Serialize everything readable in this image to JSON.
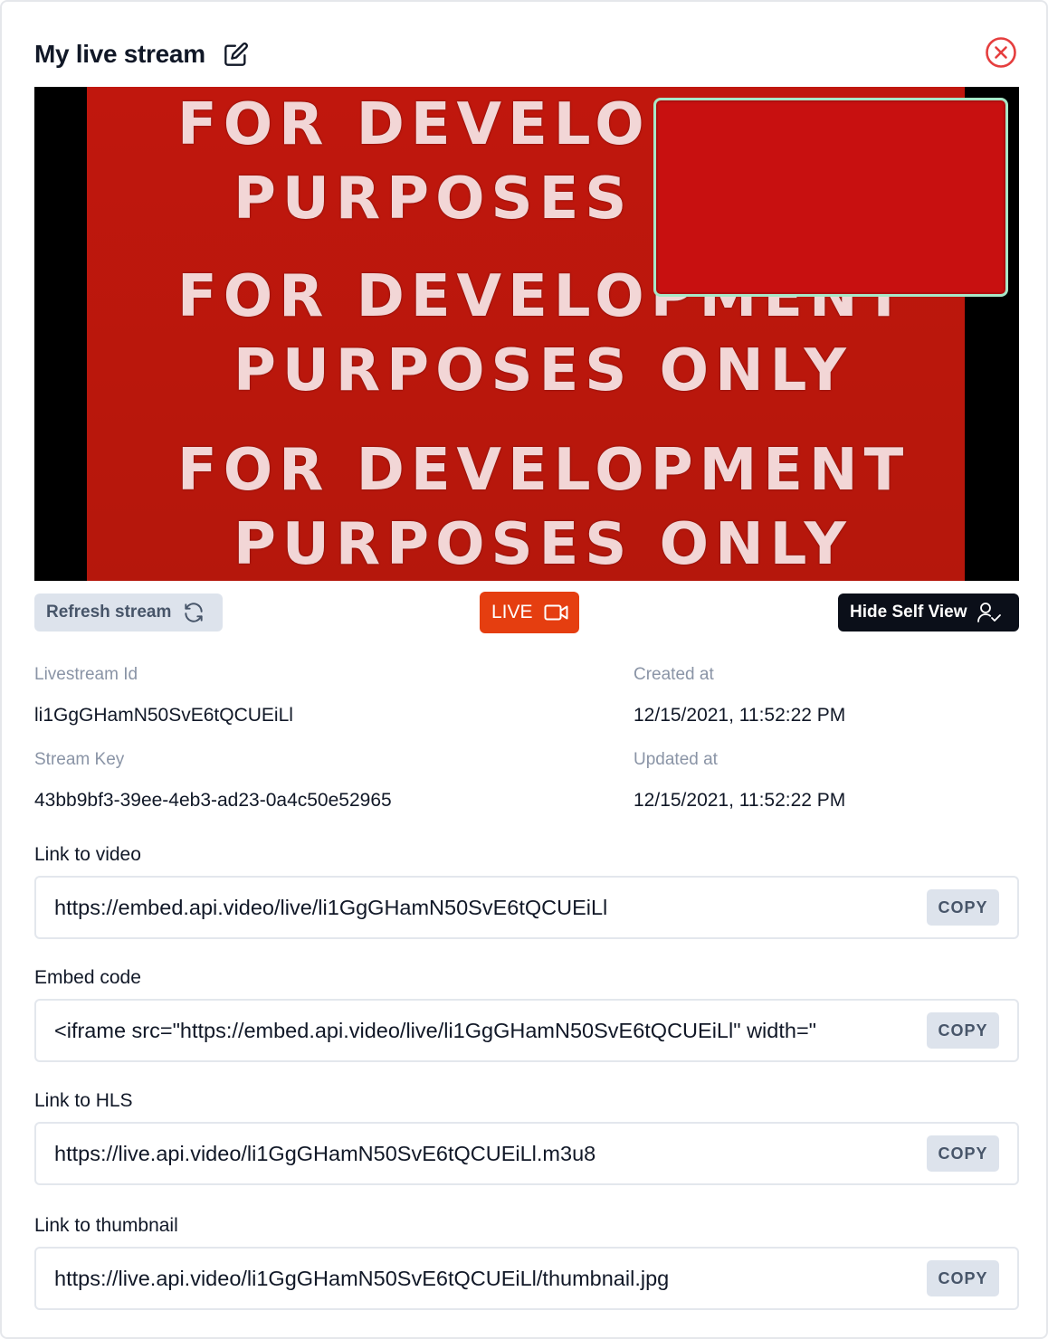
{
  "header": {
    "title": "My live stream",
    "edit_icon": "pencil-square-icon",
    "close_icon": "x-circle-icon"
  },
  "player": {
    "background_text": [
      "FOR DEVELOPMENT",
      "PURPOSES ONLY",
      "FOR DEVELOPMENT",
      "PURPOSES ONLY",
      "FOR DEVELOPMENT",
      "PURPOSES ONLY"
    ],
    "self_view_border_color": "#a7e8c8",
    "frame_color": "#c0170d"
  },
  "controls": {
    "refresh_label": "Refresh stream",
    "refresh_icon": "refresh-icon",
    "live_label": "LIVE",
    "live_icon": "video-camera-icon",
    "live_color": "#e53e10",
    "hide_self_view_label": "Hide Self View",
    "hide_self_view_icon": "user-check-icon"
  },
  "meta": {
    "livestream_id_label": "Livestream Id",
    "livestream_id": "li1GgGHamN50SvE6tQCUEiLl",
    "stream_key_label": "Stream Key",
    "stream_key": "43bb9bf3-39ee-4eb3-ad23-0a4c50e52965",
    "created_at_label": "Created at",
    "created_at": "12/15/2021, 11:52:22 PM",
    "updated_at_label": "Updated at",
    "updated_at": "12/15/2021, 11:52:22 PM"
  },
  "links": [
    {
      "label": "Link to video",
      "value": "https://embed.api.video/live/li1GgGHamN50SvE6tQCUEiLl",
      "copy_label": "COPY"
    },
    {
      "label": "Embed code",
      "value": "<iframe src=\"https://embed.api.video/live/li1GgGHamN50SvE6tQCUEiLl\" width=\"",
      "copy_label": "COPY"
    },
    {
      "label": "Link to HLS",
      "value": "https://live.api.video/li1GgGHamN50SvE6tQCUEiLl.m3u8",
      "copy_label": "COPY"
    },
    {
      "label": "Link to thumbnail",
      "value": "https://live.api.video/li1GgGHamN50SvE6tQCUEiLl/thumbnail.jpg",
      "copy_label": "COPY"
    }
  ]
}
